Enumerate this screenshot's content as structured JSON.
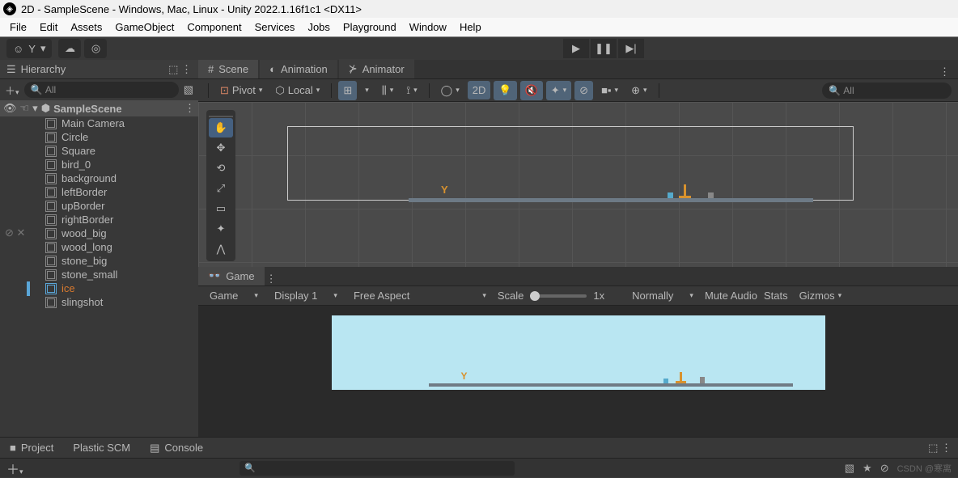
{
  "title": "2D - SampleScene - Windows, Mac, Linux - Unity 2022.1.16f1c1 <DX11>",
  "menu": [
    "File",
    "Edit",
    "Assets",
    "GameObject",
    "Component",
    "Services",
    "Jobs",
    "Playground",
    "Window",
    "Help"
  ],
  "account": {
    "letter": "Y"
  },
  "hierarchy": {
    "title": "Hierarchy",
    "search": "All",
    "scene": "SampleScene",
    "items": [
      "Main Camera",
      "Circle",
      "Square",
      "bird_0",
      "background",
      "leftBorder",
      "upBorder",
      "rightBorder",
      "wood_big",
      "wood_long",
      "stone_big",
      "stone_small",
      "ice",
      "slingshot"
    ],
    "selected": "ice"
  },
  "tabs": {
    "scene": "Scene",
    "animation": "Animation",
    "animator": "Animator"
  },
  "sceneToolbar": {
    "pivot": "Pivot",
    "local": "Local",
    "mode2d": "2D",
    "search": "All"
  },
  "sceneLabel": "Y",
  "gameTab": "Game",
  "gameToolbar": {
    "game": "Game",
    "display": "Display 1",
    "aspect": "Free Aspect",
    "scale": "Scale",
    "scaleVal": "1x",
    "normally": "Normally",
    "mute": "Mute Audio",
    "stats": "Stats",
    "gizmos": "Gizmos"
  },
  "bottomTabs": {
    "project": "Project",
    "plastic": "Plastic SCM",
    "console": "Console"
  }
}
